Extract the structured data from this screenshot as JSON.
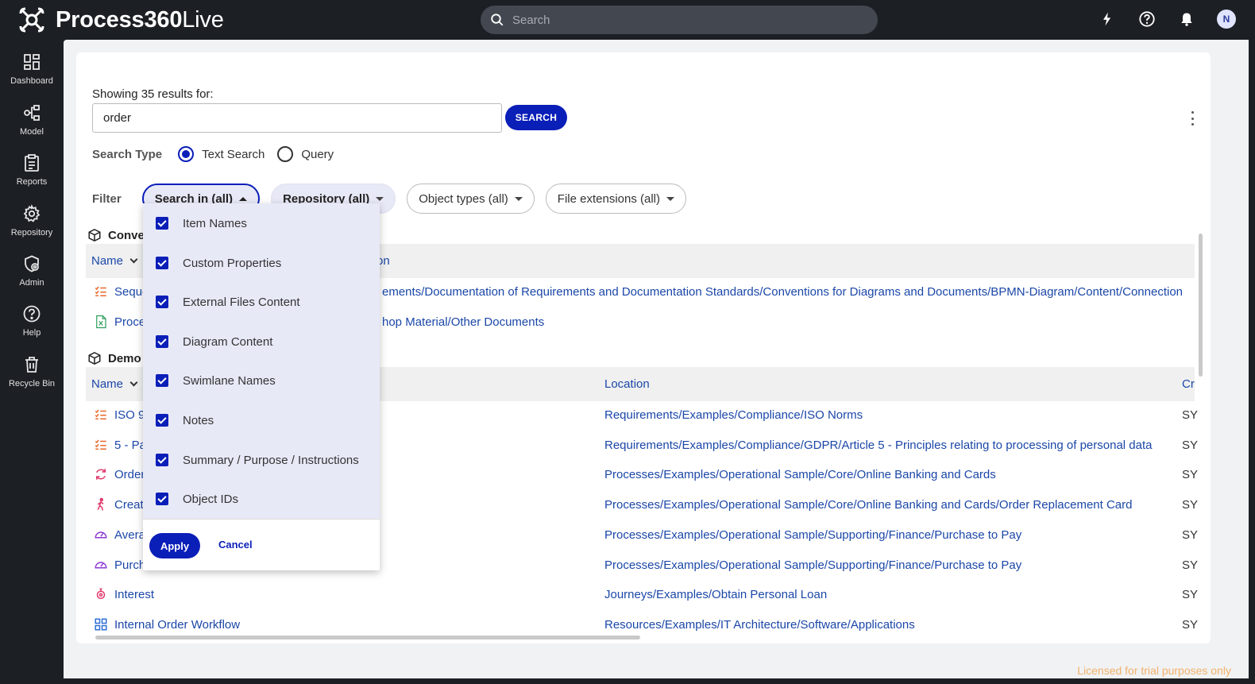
{
  "app": {
    "name_bold": "Process360",
    "name_light": "Live",
    "user_initial": "N"
  },
  "global_search": {
    "placeholder": "Search"
  },
  "sidebar": {
    "items": [
      {
        "label": "Dashboard",
        "icon": "dashboard-icon"
      },
      {
        "label": "Model",
        "icon": "model-icon"
      },
      {
        "label": "Reports",
        "icon": "reports-icon"
      },
      {
        "label": "Repository",
        "icon": "gear-icon"
      },
      {
        "label": "Admin",
        "icon": "admin-icon"
      },
      {
        "label": "Help",
        "icon": "help-icon"
      },
      {
        "label": "Recycle Bin",
        "icon": "trash-icon"
      }
    ]
  },
  "search": {
    "showing_text": "Showing 35 results for:",
    "query": "order",
    "button": "SEARCH",
    "type_label": "Search Type",
    "type_options": [
      "Text Search",
      "Query"
    ],
    "selected_type": "Text Search"
  },
  "filter": {
    "label": "Filter",
    "pills": [
      "Search in (all)",
      "Repository (all)",
      "Object types (all)",
      "File extensions (all)"
    ]
  },
  "dropdown": {
    "items": [
      "Item Names",
      "Custom Properties",
      "External Files Content",
      "Diagram Content",
      "Swimlane Names",
      "Notes",
      "Summary / Purpose / Instructions",
      "Object IDs"
    ],
    "apply": "Apply",
    "cancel": "Cancel"
  },
  "groups": [
    {
      "name": "Conver",
      "headers": {
        "name": "Name",
        "location": "on"
      },
      "rows": [
        {
          "name": "Seque",
          "location": "ements/Documentation of Requirements and Documentation Standards/Conventions for Diagrams and Documents/BPMN-Diagram/Content/Connection"
        },
        {
          "name": "Proce",
          "location": "hop Material/Other Documents"
        }
      ]
    },
    {
      "name": "Demo",
      "headers": {
        "name": "Name",
        "location": "Location",
        "created": "Cr"
      },
      "rows": [
        {
          "name": "ISO 90",
          "location": "Requirements/Examples/Compliance/ISO Norms",
          "created": "SY"
        },
        {
          "name": "5 - Pa",
          "location": "Requirements/Examples/Compliance/GDPR/Article 5 - Principles relating to processing of personal data",
          "created": "SY"
        },
        {
          "name": "Order",
          "location": "Processes/Examples/Operational Sample/Core/Online Banking and Cards",
          "created": "SY"
        },
        {
          "name": "Creat",
          "location": "Processes/Examples/Operational Sample/Core/Online Banking and Cards/Order Replacement Card",
          "created": "SY"
        },
        {
          "name": "Avera",
          "location": "Processes/Examples/Operational Sample/Supporting/Finance/Purchase to Pay",
          "created": "SY"
        },
        {
          "name": "Purch",
          "location": "Processes/Examples/Operational Sample/Supporting/Finance/Purchase to Pay",
          "created": "SY"
        },
        {
          "name": "Interest",
          "location": "Journeys/Examples/Obtain Personal Loan",
          "created": "SY"
        },
        {
          "name": "Internal Order Workflow",
          "location": "Resources/Examples/IT Architecture/Software/Applications",
          "created": "SY"
        }
      ]
    }
  ],
  "license_text": "Licensed for trial purposes only",
  "colors": {
    "accent": "#0a1eb8",
    "link": "#1b47a8",
    "license": "#f1b26b"
  }
}
